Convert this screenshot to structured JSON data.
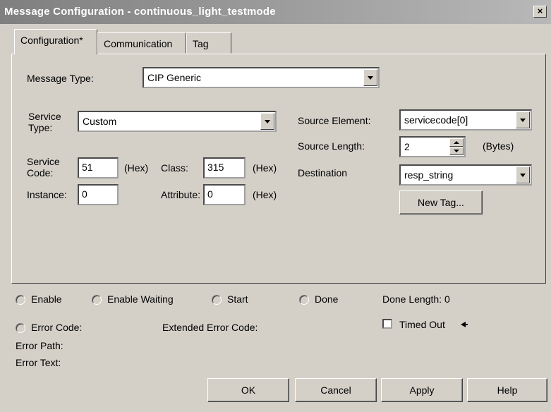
{
  "window": {
    "title": "Message Configuration - continuous_light_testmode",
    "close_glyph": "×"
  },
  "tabs": [
    {
      "label": "Configuration*",
      "active": true
    },
    {
      "label": "Communication",
      "active": false
    },
    {
      "label": "Tag",
      "active": false
    }
  ],
  "config": {
    "message_type_label": "Message Type:",
    "message_type_value": "CIP Generic",
    "service_type_label_1": "Service",
    "service_type_label_2": "Type:",
    "service_type_value": "Custom",
    "service_code_label_1": "Service",
    "service_code_label_2": "Code:",
    "service_code_value": "51",
    "service_code_unit": "(Hex)",
    "class_label": "Class:",
    "class_value": "315",
    "class_unit": "(Hex)",
    "instance_label": "Instance:",
    "instance_value": "0",
    "attribute_label": "Attribute:",
    "attribute_value": "0",
    "attribute_unit": "(Hex)",
    "source_element_label": "Source Element:",
    "source_element_value": "servicecode[0]",
    "source_length_label": "Source Length:",
    "source_length_value": "2",
    "source_length_unit": "(Bytes)",
    "destination_label": "Destination",
    "destination_value": "resp_string",
    "new_tag_label": "New Tag..."
  },
  "status": {
    "enable": "Enable",
    "enable_waiting": "Enable Waiting",
    "start": "Start",
    "done": "Done",
    "done_length": "Done Length: 0",
    "error_code": "Error Code:",
    "extended_error_code": "Extended Error Code:",
    "timed_out": "Timed Out",
    "error_path": "Error Path:",
    "error_text": "Error Text:"
  },
  "buttons": {
    "ok": "OK",
    "cancel": "Cancel",
    "apply": "Apply",
    "help": "Help"
  },
  "colors": {
    "face": "#d4d0c8",
    "title_bar": "#7f7f7f"
  }
}
